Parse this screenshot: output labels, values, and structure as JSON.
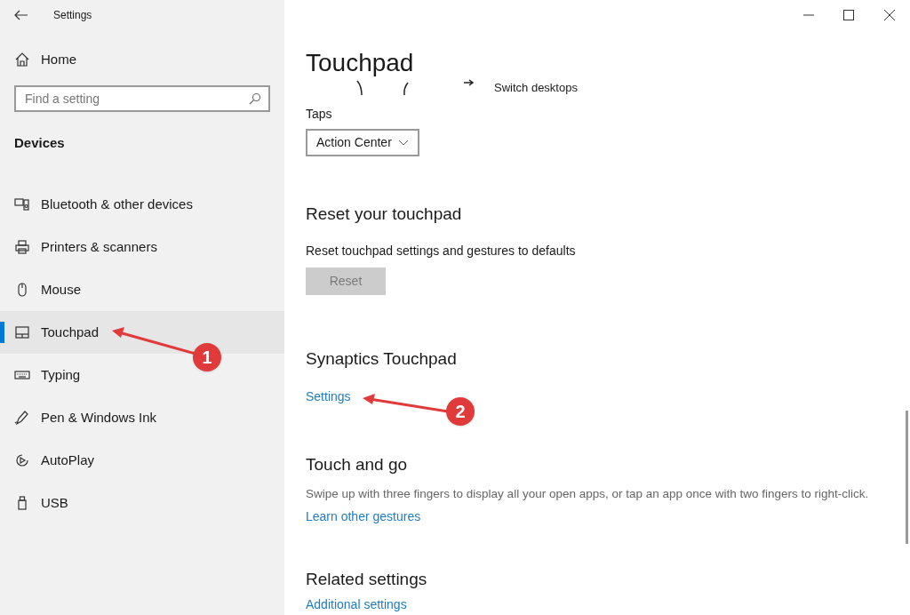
{
  "window": {
    "title": "Settings"
  },
  "sidebar": {
    "home": "Home",
    "search": {
      "placeholder": "Find a setting"
    },
    "section": "Devices",
    "items": [
      {
        "label": "Bluetooth & other devices",
        "kind": "bluetooth",
        "selected": false
      },
      {
        "label": "Printers & scanners",
        "kind": "printer",
        "selected": false
      },
      {
        "label": "Mouse",
        "kind": "mouse",
        "selected": false
      },
      {
        "label": "Touchpad",
        "kind": "touchpad",
        "selected": true
      },
      {
        "label": "Typing",
        "kind": "keyboard",
        "selected": false
      },
      {
        "label": "Pen & Windows Ink",
        "kind": "pen",
        "selected": false
      },
      {
        "label": "AutoPlay",
        "kind": "autoplay",
        "selected": false
      },
      {
        "label": "USB",
        "kind": "usb",
        "selected": false
      }
    ]
  },
  "page": {
    "title": "Touchpad",
    "gesture_action": "Switch desktops",
    "taps": {
      "label": "Taps",
      "value": "Action Center"
    },
    "reset": {
      "heading": "Reset your touchpad",
      "description": "Reset touchpad settings and gestures to defaults",
      "button": "Reset",
      "disabled": true
    },
    "synaptics": {
      "heading": "Synaptics Touchpad",
      "link": "Settings"
    },
    "touch_and_go": {
      "heading": "Touch and go",
      "description": "Swipe up with three fingers to display all your open apps, or tap an app once with two fingers to right-click.",
      "link": "Learn other gestures"
    },
    "related": {
      "heading": "Related settings",
      "link": "Additional settings"
    }
  },
  "annotations": [
    {
      "label": "1"
    },
    {
      "label": "2"
    }
  ]
}
